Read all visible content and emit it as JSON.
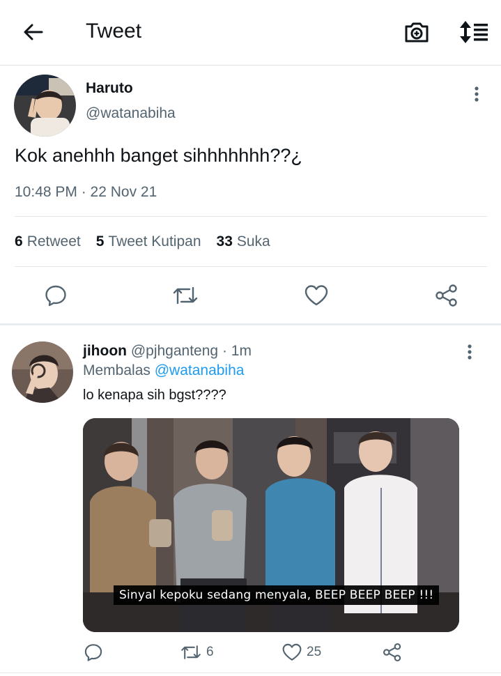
{
  "header": {
    "title": "Tweet",
    "back_icon": "arrow-left-icon",
    "camera_icon": "camera-plus-icon",
    "sort_icon": "sort-list-icon"
  },
  "tweet": {
    "author_name": "Haruto",
    "author_handle": "@watanabiha",
    "text": "Kok anehhh banget sihhhhhhh??¿",
    "time": "10:48 PM · 22 Nov 21",
    "stats": {
      "retweets_count": "6",
      "retweets_label": "Retweet",
      "quotes_count": "5",
      "quotes_label": "Tweet Kutipan",
      "likes_count": "33",
      "likes_label": "Suka"
    },
    "actions": [
      "reply-icon",
      "retweet-icon",
      "like-icon",
      "share-icon"
    ]
  },
  "reply": {
    "author_name": "jihoon",
    "author_handle": "@pjhganteng",
    "separator": "·",
    "time": "1m",
    "replying_label": "Membalas",
    "replying_to": "@watanabiha",
    "text": "lo kenapa sih bgst????",
    "media_caption": "Sinyal kepoku sedang menyala, BEEP BEEP BEEP !!!",
    "retweet_count": "6",
    "like_count": "25"
  },
  "colors": {
    "text": "#0f1419",
    "secondary": "#536471",
    "link": "#1d9bf0",
    "divider": "#e1e6ea"
  }
}
